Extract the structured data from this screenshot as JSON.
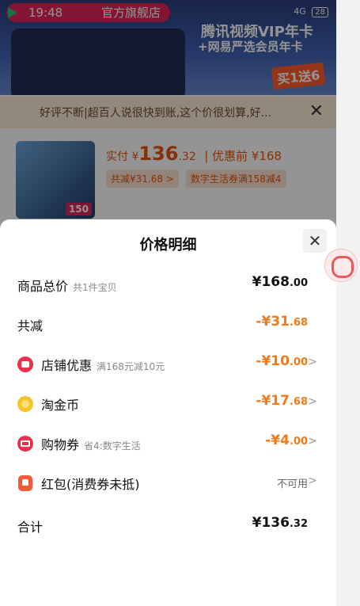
{
  "status": {
    "time": "19:48",
    "shop": "官方旗舰店",
    "battery": "28",
    "net": "4G"
  },
  "background": {
    "promo_line1": "腾讯视频VIP年卡",
    "promo_line2": "+网易严选会员年卡",
    "promo_badge": "买1送6",
    "notice": "好评不断|超百人说很快到账,这个价很划算,好...",
    "price_prefix": "实付 ¥",
    "price_int": "136",
    "price_dec": ".32",
    "price_before": "| 优惠前 ¥168",
    "chip1": "共减¥31.68 >",
    "chip2": "数字生活券满158减4",
    "img_tag": "150"
  },
  "sheet": {
    "title": "价格明细",
    "rows": [
      {
        "label": "商品总价",
        "sub": "共1件宝贝",
        "val_int": "¥168",
        "val_dec": ".00"
      },
      {
        "label": "共减",
        "sub": "",
        "val_int": "-¥31",
        "val_dec": ".68"
      },
      {
        "label": "店铺优惠",
        "sub": "满168元减10元",
        "val_int": "-¥10",
        "val_dec": ".00"
      },
      {
        "label": "淘金币",
        "sub": "",
        "val_int": "-¥17",
        "val_dec": ".68"
      },
      {
        "label": "购物券",
        "sub": "省4:数字生活",
        "val_int": "-¥4",
        "val_dec": ".00"
      },
      {
        "label": "红包(消费券未抵)",
        "sub": "",
        "val_text": "不可用"
      },
      {
        "label": "合计",
        "sub": "",
        "val_int": "¥136",
        "val_dec": ".32"
      }
    ]
  },
  "icons": {
    "close": "close-icon",
    "chevron": "chevron-right-icon",
    "shop_discount": "shop-icon",
    "coin": "coin-icon",
    "coupon": "coupon-icon",
    "red_packet": "red-packet-icon"
  },
  "colors": {
    "accent_orange": "#f27a1a",
    "brand_red": "#e8314d"
  }
}
